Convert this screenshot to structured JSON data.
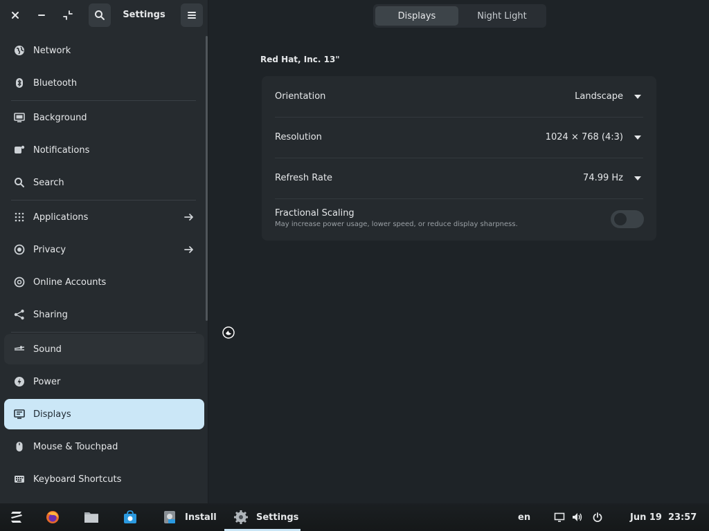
{
  "window": {
    "title": "Settings"
  },
  "sidebar": {
    "items": [
      {
        "label": "Network",
        "icon": "network-globe-icon"
      },
      {
        "label": "Bluetooth",
        "icon": "bluetooth-icon"
      },
      {
        "label": "Background",
        "icon": "background-icon"
      },
      {
        "label": "Notifications",
        "icon": "notifications-icon"
      },
      {
        "label": "Search",
        "icon": "search-icon"
      },
      {
        "label": "Applications",
        "icon": "applications-grid-icon",
        "has_arrow": true
      },
      {
        "label": "Privacy",
        "icon": "privacy-icon",
        "has_arrow": true
      },
      {
        "label": "Online Accounts",
        "icon": "online-accounts-icon"
      },
      {
        "label": "Sharing",
        "icon": "sharing-icon"
      },
      {
        "label": "Sound",
        "icon": "sound-icon"
      },
      {
        "label": "Power",
        "icon": "power-icon"
      },
      {
        "label": "Displays",
        "icon": "displays-icon",
        "active": true
      },
      {
        "label": "Mouse & Touchpad",
        "icon": "mouse-icon"
      },
      {
        "label": "Keyboard Shortcuts",
        "icon": "keyboard-icon"
      }
    ]
  },
  "tabs": [
    {
      "label": "Displays",
      "active": true
    },
    {
      "label": "Night Light",
      "active": false
    }
  ],
  "display": {
    "monitor_name": "Red Hat, Inc. 13\"",
    "orientation": {
      "label": "Orientation",
      "value": "Landscape"
    },
    "resolution": {
      "label": "Resolution",
      "value": "1024 × 768 (4:3)"
    },
    "refresh_rate": {
      "label": "Refresh Rate",
      "value": "74.99 Hz"
    },
    "fractional_scaling": {
      "label": "Fractional Scaling",
      "description": "May increase power usage, lower speed, or reduce display sharpness.",
      "enabled": false
    }
  },
  "taskbar": {
    "apps": [
      {
        "name": "zorin-menu-icon"
      },
      {
        "name": "firefox-icon"
      },
      {
        "name": "files-icon"
      },
      {
        "name": "software-store-icon"
      },
      {
        "name": "installer-icon",
        "label": "Install"
      },
      {
        "name": "settings-gear-icon",
        "label": "Settings",
        "active": true
      }
    ],
    "keyboard_layout": "en",
    "date": "Jun 19",
    "time": "23:57"
  },
  "colors": {
    "accent": "#cbe7f7",
    "background": "#1e2327",
    "sidebar": "#262b2f",
    "card": "#252a2e"
  }
}
